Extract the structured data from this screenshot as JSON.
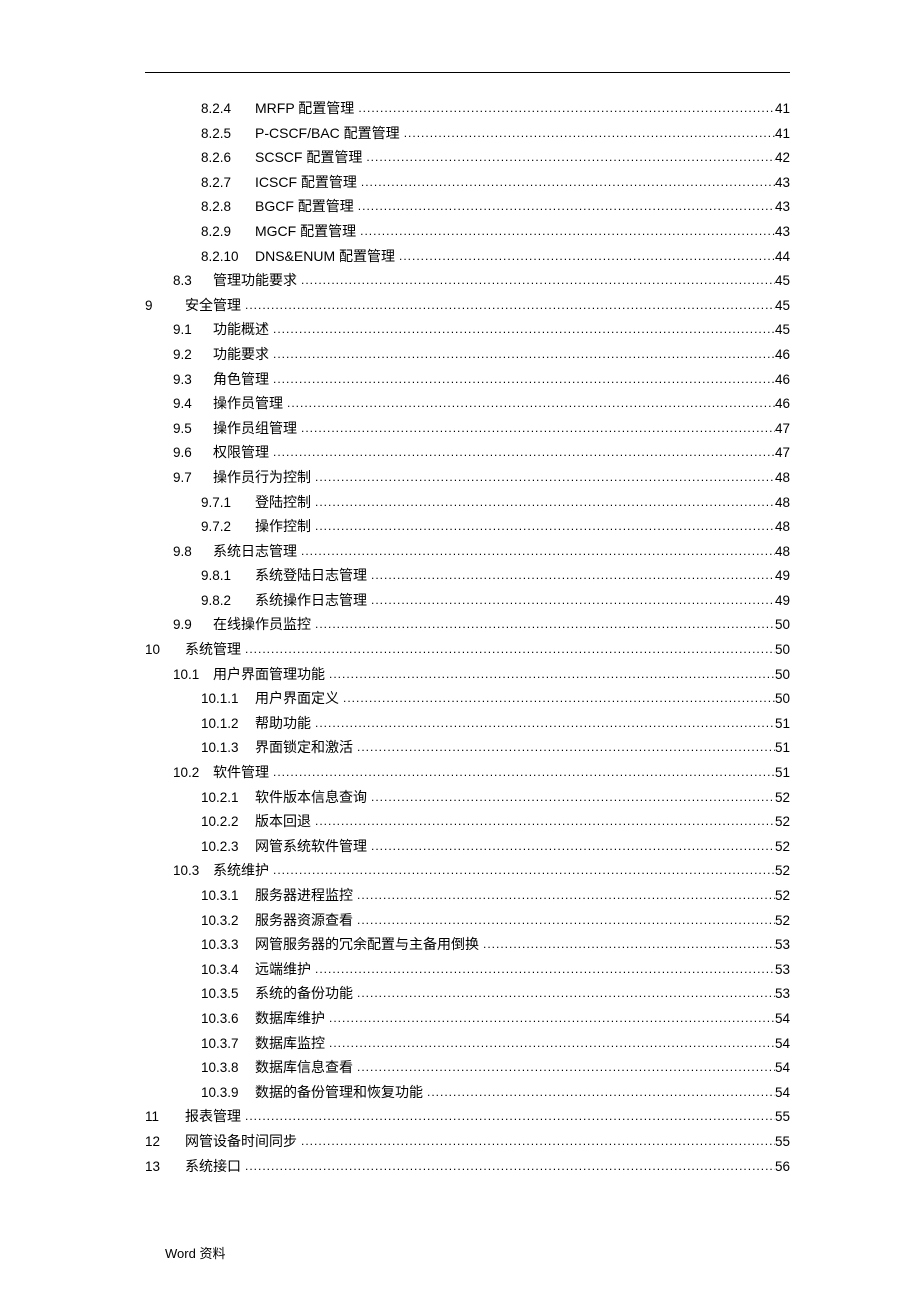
{
  "toc": [
    {
      "level": 3,
      "num": "8.2.4",
      "title": "MRFP 配置管理",
      "page": "41"
    },
    {
      "level": 3,
      "num": "8.2.5",
      "title": "P-CSCF/BAC 配置管理",
      "page": "41"
    },
    {
      "level": 3,
      "num": "8.2.6",
      "title": "SCSCF 配置管理 ",
      "page": "42"
    },
    {
      "level": 3,
      "num": "8.2.7",
      "title": "ICSCF 配置管理",
      "page": "43"
    },
    {
      "level": 3,
      "num": "8.2.8",
      "title": "BGCF 配置管理 ",
      "page": "43"
    },
    {
      "level": 3,
      "num": "8.2.9",
      "title": "MGCF 配置管理",
      "page": "43"
    },
    {
      "level": 3,
      "num": "8.2.10",
      "title": "DNS&ENUM 配置管理 ",
      "page": "44"
    },
    {
      "level": 2,
      "num": "8.3",
      "title": "管理功能要求",
      "page": "45"
    },
    {
      "level": 1,
      "num": "9",
      "title": "安全管理",
      "page": "45"
    },
    {
      "level": 2,
      "num": "9.1",
      "title": "功能概述",
      "page": "45"
    },
    {
      "level": 2,
      "num": "9.2",
      "title": "功能要求",
      "page": "46"
    },
    {
      "level": 2,
      "num": "9.3",
      "title": "角色管理",
      "page": "46"
    },
    {
      "level": 2,
      "num": "9.4",
      "title": "操作员管理 ",
      "page": "46"
    },
    {
      "level": 2,
      "num": "9.5",
      "title": "操作员组管理",
      "page": "47"
    },
    {
      "level": 2,
      "num": "9.6",
      "title": "权限管理",
      "page": "47"
    },
    {
      "level": 2,
      "num": "9.7",
      "title": "操作员行为控制 ",
      "page": "48"
    },
    {
      "level": 3,
      "num": "9.7.1",
      "title": "登陆控制 ",
      "page": "48"
    },
    {
      "level": 3,
      "num": "9.7.2",
      "title": "操作控制 ",
      "page": "48"
    },
    {
      "level": 2,
      "num": "9.8",
      "title": "系统日志管理",
      "page": "48"
    },
    {
      "level": 3,
      "num": "9.8.1",
      "title": "系统登陆日志管理",
      "page": "49"
    },
    {
      "level": 3,
      "num": "9.8.2",
      "title": "系统操作日志管理",
      "page": "49"
    },
    {
      "level": 2,
      "num": "9.9",
      "title": "在线操作员监控 ",
      "page": "50"
    },
    {
      "level": 1,
      "num": "10",
      "title": "系统管理 ",
      "page": "50"
    },
    {
      "level": 2,
      "num": "10.1",
      "title": "用户界面管理功能",
      "page": "50"
    },
    {
      "level": 3,
      "num": "10.1.1",
      "title": "用户界面定义",
      "page": "50"
    },
    {
      "level": 3,
      "num": "10.1.2",
      "title": "帮助功能 ",
      "page": "51"
    },
    {
      "level": 3,
      "num": "10.1.3",
      "title": "界面锁定和激活 ",
      "page": "51"
    },
    {
      "level": 2,
      "num": "10.2",
      "title": "软件管理 ",
      "page": "51"
    },
    {
      "level": 3,
      "num": "10.2.1",
      "title": "软件版本信息查询",
      "page": "52"
    },
    {
      "level": 3,
      "num": "10.2.2",
      "title": "版本回退 ",
      "page": "52"
    },
    {
      "level": 3,
      "num": "10.2.3",
      "title": "网管系统软件管理",
      "page": "52"
    },
    {
      "level": 2,
      "num": "10.3",
      "title": "系统维护 ",
      "page": "52"
    },
    {
      "level": 3,
      "num": "10.3.1",
      "title": "服务器进程监控 ",
      "page": "52"
    },
    {
      "level": 3,
      "num": "10.3.2",
      "title": "服务器资源查看 ",
      "page": "52"
    },
    {
      "level": 3,
      "num": "10.3.3",
      "title": "网管服务器的冗余配置与主备用倒换 ",
      "page": "53"
    },
    {
      "level": 3,
      "num": "10.3.4",
      "title": "远端维护 ",
      "page": "53"
    },
    {
      "level": 3,
      "num": "10.3.5",
      "title": "系统的备份功能 ",
      "page": "53"
    },
    {
      "level": 3,
      "num": "10.3.6",
      "title": "数据库维护",
      "page": "54"
    },
    {
      "level": 3,
      "num": "10.3.7",
      "title": "数据库监控",
      "page": "54"
    },
    {
      "level": 3,
      "num": "10.3.8",
      "title": "数据库信息查看 ",
      "page": "54"
    },
    {
      "level": 3,
      "num": "10.3.9",
      "title": "数据的备份管理和恢复功能",
      "page": "54"
    },
    {
      "level": 1,
      "num": "11",
      "title": "报表管理 ",
      "page": "55"
    },
    {
      "level": 1,
      "num": "12",
      "title": "网管设备时间同步 ",
      "page": "55"
    },
    {
      "level": 1,
      "num": "13",
      "title": "系统接口 ",
      "page": "56"
    }
  ],
  "footer": {
    "word": "Word",
    "label": "资料"
  }
}
